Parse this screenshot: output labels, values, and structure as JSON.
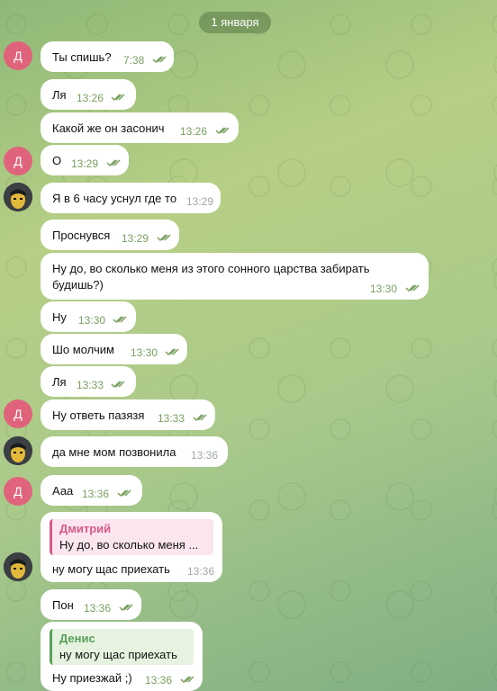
{
  "chat": {
    "date": "1 января",
    "messages": [
      {
        "sender": "Д",
        "text": "Ты спишь?",
        "time": "7:38"
      },
      {
        "text": "Ля",
        "time": "13:26"
      },
      {
        "text": "Какой же он засонич",
        "time": "13:26"
      },
      {
        "sender": "Д",
        "text": "О",
        "time": "13:29"
      },
      {
        "text": "Я в 6 часу уснул где то",
        "time": "13:29"
      },
      {
        "text": "Проснувся",
        "time": "13:29"
      },
      {
        "text_line1": "Ну до, во сколько меня из этого сонного царства забирать",
        "text_line2": "будишь?)",
        "time": "13:30"
      },
      {
        "text": "Ну",
        "time": "13:30"
      },
      {
        "text": "Шо молчим",
        "time": "13:30"
      },
      {
        "text": "Ля",
        "time": "13:33"
      },
      {
        "sender": "Д",
        "text": "Ну ответь пазязя",
        "time": "13:33"
      },
      {
        "text": "да мне мом позвонила",
        "time": "13:36"
      },
      {
        "sender": "Д",
        "text": "Ааа",
        "time": "13:36"
      },
      {
        "reply_name": "Дмитрий",
        "reply_text": "Ну до, во сколько меня ...",
        "text": "ну могу щас приехать",
        "time": "13:36"
      },
      {
        "text": "Пон",
        "time": "13:36"
      },
      {
        "reply_name": "Денис",
        "reply_text": "ну могу щас приехать",
        "text": "Ну приезжай ;)",
        "time": "13:36"
      }
    ]
  },
  "colors": {
    "avatar_d": "#e0637c",
    "reply_pink": "#d85a8a",
    "reply_green": "#5aa05a"
  }
}
